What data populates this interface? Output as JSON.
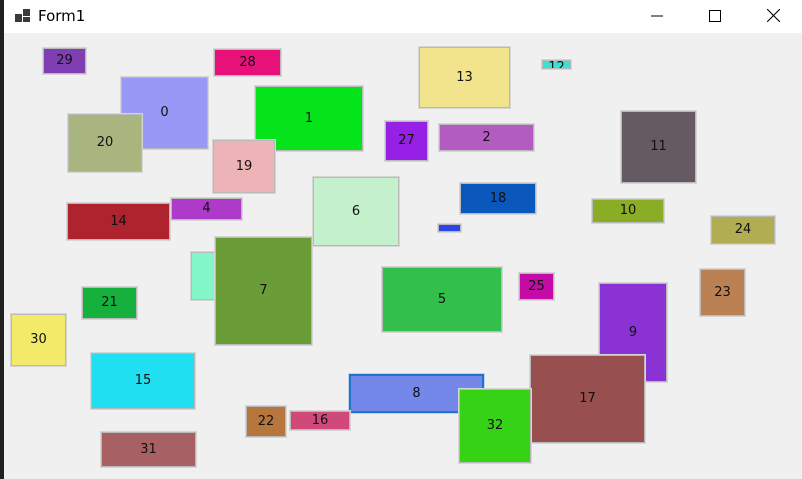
{
  "window": {
    "title": "Form1"
  },
  "boxes": [
    {
      "label": "29",
      "color": "#7f3fb2"
    },
    {
      "label": "28",
      "color": "#e8117a"
    },
    {
      "label": "13",
      "color": "#f2e48c"
    },
    {
      "label": "12",
      "color": "#38e2d6"
    },
    {
      "label": "0",
      "color": "#9898f7"
    },
    {
      "label": "1",
      "color": "#05e41a"
    },
    {
      "label": "20",
      "color": "#a9b57f"
    },
    {
      "label": "27",
      "color": "#9620e6"
    },
    {
      "label": "2",
      "color": "#b25bc0"
    },
    {
      "label": "11",
      "color": "#655962"
    },
    {
      "label": "19",
      "color": "#ecb4b6"
    },
    {
      "label": "6",
      "color": "#c4f0cc"
    },
    {
      "label": "18",
      "color": "#0b58bc"
    },
    {
      "label": "14",
      "color": "#ae232e"
    },
    {
      "label": "4",
      "color": "#ad3ac8"
    },
    {
      "label": "",
      "color": "#2c45e6"
    },
    {
      "label": "10",
      "color": "#8aad25"
    },
    {
      "label": "24",
      "color": "#b0ad52"
    },
    {
      "label": "",
      "color": "#82f6c8"
    },
    {
      "label": "7",
      "color": "#6a9d38"
    },
    {
      "label": "5",
      "color": "#33bf4b"
    },
    {
      "label": "25",
      "color": "#c50ba6"
    },
    {
      "label": "23",
      "color": "#bb8152"
    },
    {
      "label": "21",
      "color": "#16b03c"
    },
    {
      "label": "9",
      "color": "#8a32d3"
    },
    {
      "label": "30",
      "color": "#f3ea69"
    },
    {
      "label": "15",
      "color": "#1fdff1"
    },
    {
      "label": "17",
      "color": "#984f4f"
    },
    {
      "label": "8",
      "color": "#7388e9"
    },
    {
      "label": "22",
      "color": "#b7763e"
    },
    {
      "label": "16",
      "color": "#d04978"
    },
    {
      "label": "32",
      "color": "#35d216"
    },
    {
      "label": "31",
      "color": "#a86162"
    }
  ]
}
